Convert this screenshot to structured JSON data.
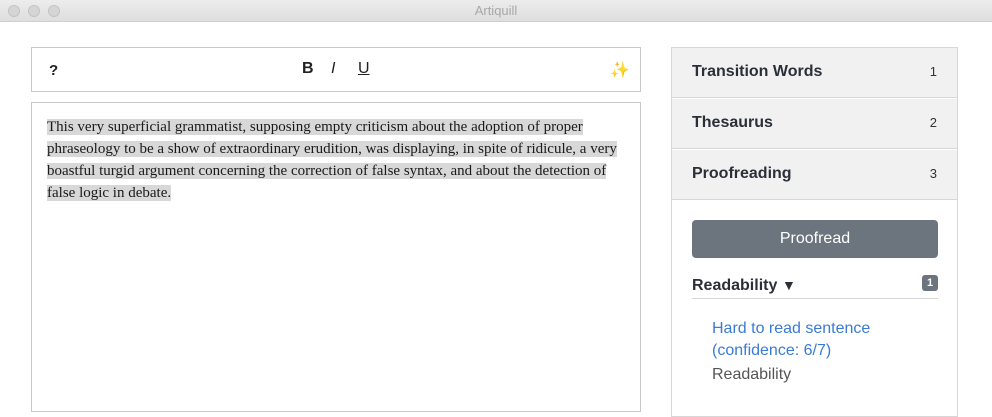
{
  "window": {
    "title": "Artiquill"
  },
  "toolbar": {
    "help_label": "?",
    "bold_label": "B",
    "italic_label": "I",
    "underline_label": "U",
    "magic_icon": "✨"
  },
  "editor": {
    "text": "This very superficial grammatist, supposing empty criticism about the adoption of proper phraseology to be a show of extraordinary erudition, was displaying, in spite of ridicule, a very boastful turgid argument concerning the correction of false syntax, and about the detection of false logic in debate."
  },
  "sidebar": {
    "sections": [
      {
        "label": "Transition Words",
        "num": "1"
      },
      {
        "label": "Thesaurus",
        "num": "2"
      },
      {
        "label": "Proofreading",
        "num": "3"
      }
    ],
    "proofread_button": "Proofread",
    "readability": {
      "label": "Readability",
      "arrow": "▼",
      "badge": "1",
      "issue": "Hard to read sentence (confidence: 6/7)",
      "category": "Readability"
    }
  }
}
